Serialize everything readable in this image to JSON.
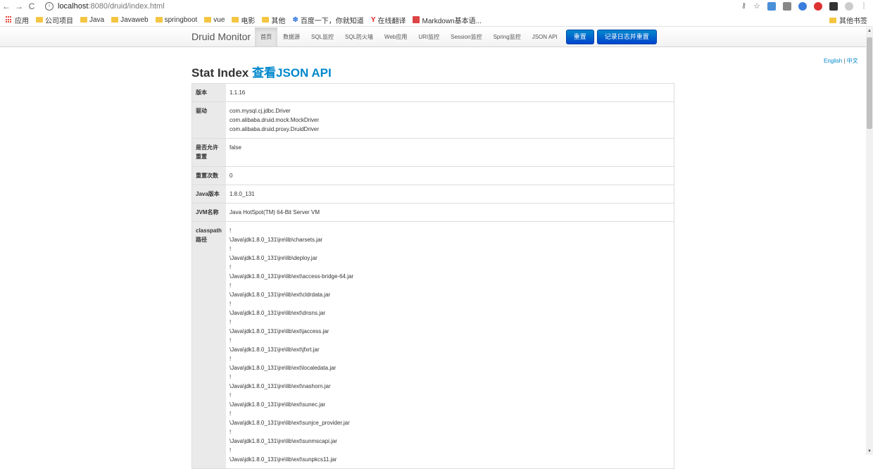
{
  "browser": {
    "host": "localhost",
    "path": ":8080/druid/index.html",
    "bookmarks": [
      "应用",
      "公司项目",
      "Java",
      "Javaweb",
      "springboot",
      "vue",
      "电影",
      "其他",
      "百度一下，你就知道",
      "在线翻译",
      "Markdown基本语..."
    ],
    "other_bookmarks": "其他书签"
  },
  "navbar": {
    "brand": "Druid Monitor",
    "items": [
      "首页",
      "数据源",
      "SQL监控",
      "SQL防火墙",
      "Web应用",
      "URI监控",
      "Session监控",
      "Spring监控",
      "JSON API"
    ],
    "reset_button": "重置",
    "log_reset_button": "记录日志并重置"
  },
  "lang": {
    "en": "English",
    "sep": "|",
    "zh": "中文"
  },
  "page": {
    "title": "Stat Index",
    "json_link": "查看JSON API"
  },
  "stats": {
    "version": {
      "label": "版本",
      "value": "1.1.16"
    },
    "driver": {
      "label": "驱动",
      "values": [
        "com.mysql.cj.jdbc.Driver",
        "com.alibaba.druid.mock.MockDriver",
        "com.alibaba.druid.proxy.DruidDriver"
      ]
    },
    "allow_reset": {
      "label_1": "是否允许",
      "label_2": "重置",
      "value": "false"
    },
    "reset_count": {
      "label": "重置次数",
      "value": "0"
    },
    "java_version": {
      "label": "Java版本",
      "value": "1.8.0_131"
    },
    "jvm_name": {
      "label": "JVM名称",
      "value": "Java HotSpot(TM) 64-Bit Server VM"
    },
    "classpath": {
      "label_1": "classpath",
      "label_2": "路径",
      "separator": "!",
      "entries": [
        "\\Java\\jdk1.8.0_131\\jre\\lib\\charsets.jar",
        "\\Java\\jdk1.8.0_131\\jre\\lib\\deploy.jar",
        "\\Java\\jdk1.8.0_131\\jre\\lib\\ext\\access-bridge-64.jar",
        "\\Java\\jdk1.8.0_131\\jre\\lib\\ext\\cldrdata.jar",
        "\\Java\\jdk1.8.0_131\\jre\\lib\\ext\\dnsns.jar",
        "\\Java\\jdk1.8.0_131\\jre\\lib\\ext\\jaccess.jar",
        "\\Java\\jdk1.8.0_131\\jre\\lib\\ext\\jfxrt.jar",
        "\\Java\\jdk1.8.0_131\\jre\\lib\\ext\\localedata.jar",
        "\\Java\\jdk1.8.0_131\\jre\\lib\\ext\\nashorn.jar",
        "\\Java\\jdk1.8.0_131\\jre\\lib\\ext\\sunec.jar",
        "\\Java\\jdk1.8.0_131\\jre\\lib\\ext\\sunjce_provider.jar",
        "\\Java\\jdk1.8.0_131\\jre\\lib\\ext\\sunmscapi.jar",
        "\\Java\\jdk1.8.0_131\\jre\\lib\\ext\\sunpkcs11.jar"
      ]
    }
  }
}
